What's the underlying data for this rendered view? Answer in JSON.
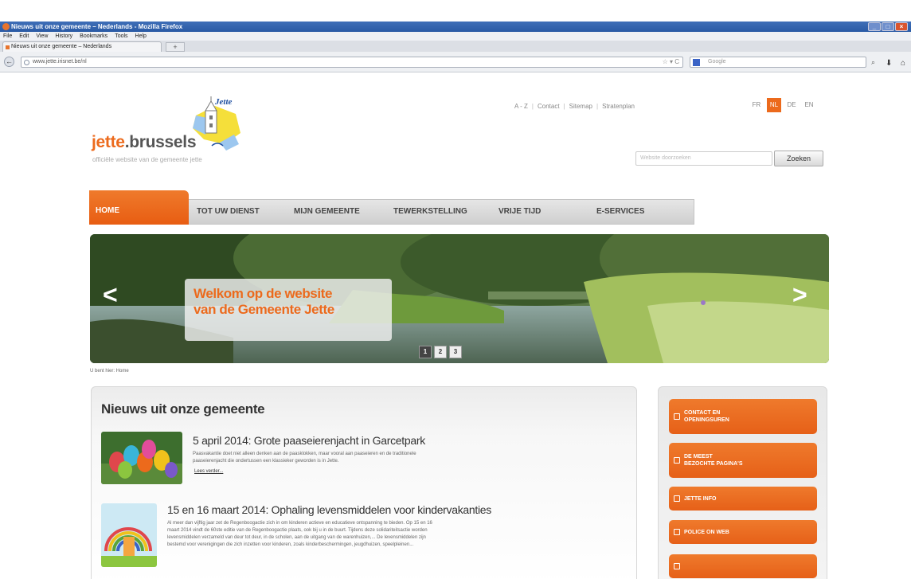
{
  "browser": {
    "window_title": "Nieuws uit onze gemeente – Nederlands - Mozilla Firefox",
    "menu": [
      "File",
      "Edit",
      "View",
      "History",
      "Bookmarks",
      "Tools",
      "Help"
    ],
    "tab_title": "Nieuws uit onze gemeente – Nederlands",
    "new_tab": "+",
    "url": "www.jette.irisnet.be/nl",
    "search_placeholder": "Google",
    "back": "←"
  },
  "site": {
    "logo_brand": "jette",
    "logo_suffix": ".brussels",
    "logo_tagline": "officiële website van de gemeente jette",
    "logo_sign": "Jette",
    "top_links": [
      "A - Z",
      "Contact",
      "Sitemap",
      "Stratenplan"
    ],
    "languages": [
      "FR",
      "NL",
      "DE",
      "EN"
    ],
    "active_language": "NL",
    "search_placeholder": "Website doorzoeken",
    "search_button": "Zoeken",
    "nav": [
      "HOME",
      "TOT UW DIENST",
      "MIJN GEMEENTE",
      "TEWERKSTELLING",
      "VRIJE TIJD",
      "E-SERVICES"
    ],
    "hero": {
      "line1": "Welkom op de website",
      "line2": "van de Gemeente Jette",
      "prev": "<",
      "next": ">",
      "pages": [
        "1",
        "2",
        "3"
      ]
    },
    "breadcrumb": "U bent hier: Home",
    "news": {
      "heading": "Nieuws uit onze gemeente",
      "items": [
        {
          "title": "5 april 2014: Grote paaseierenjacht in Garcetpark",
          "text1": "Paasvakantie doet niet alleen denken aan de paasklokken, maar vooral aan paaseieren en de traditionele",
          "text2": "paaseierenjacht die ondertussen een klassieker geworden is in Jette.",
          "more": "Lees verder..."
        },
        {
          "title": "15 en 16 maart 2014: Ophaling levensmiddelen voor kindervakanties",
          "text1": "Al meer dan vijftig jaar zet de Regenboogactie zich in om kinderen actieve en educatieve ontspanning te bieden. Op 15 en 16",
          "text2": "maart 2014 vindt de 60ste editie van de Regenboogactie plaats, ook bij u in de buurt. Tijdens deze solidariteitsactie worden",
          "text3": "levensmiddelen verzameld van deur tot deur, in de scholen, aan de uitgang van de warenhuizen,... De levensmiddelen zijn",
          "text4": "bestemd voor verenigingen die zich inzetten voor kinderen, zoals kinderbeschermingen, jeugdhuizen, speelpleinen..."
        }
      ]
    },
    "sidebar": [
      [
        "CONTACT EN",
        "OPENINGSUREN"
      ],
      [
        "DE MEEST",
        "BEZOCHTE PAGINA'S"
      ],
      [
        "JETTE INFO"
      ],
      [
        "POLICE ON WEB"
      ]
    ],
    "colors": {
      "accent": "#ec6a1c",
      "nav_bg": "#d6d6d6",
      "titlebar": "#2a5aa5"
    }
  }
}
